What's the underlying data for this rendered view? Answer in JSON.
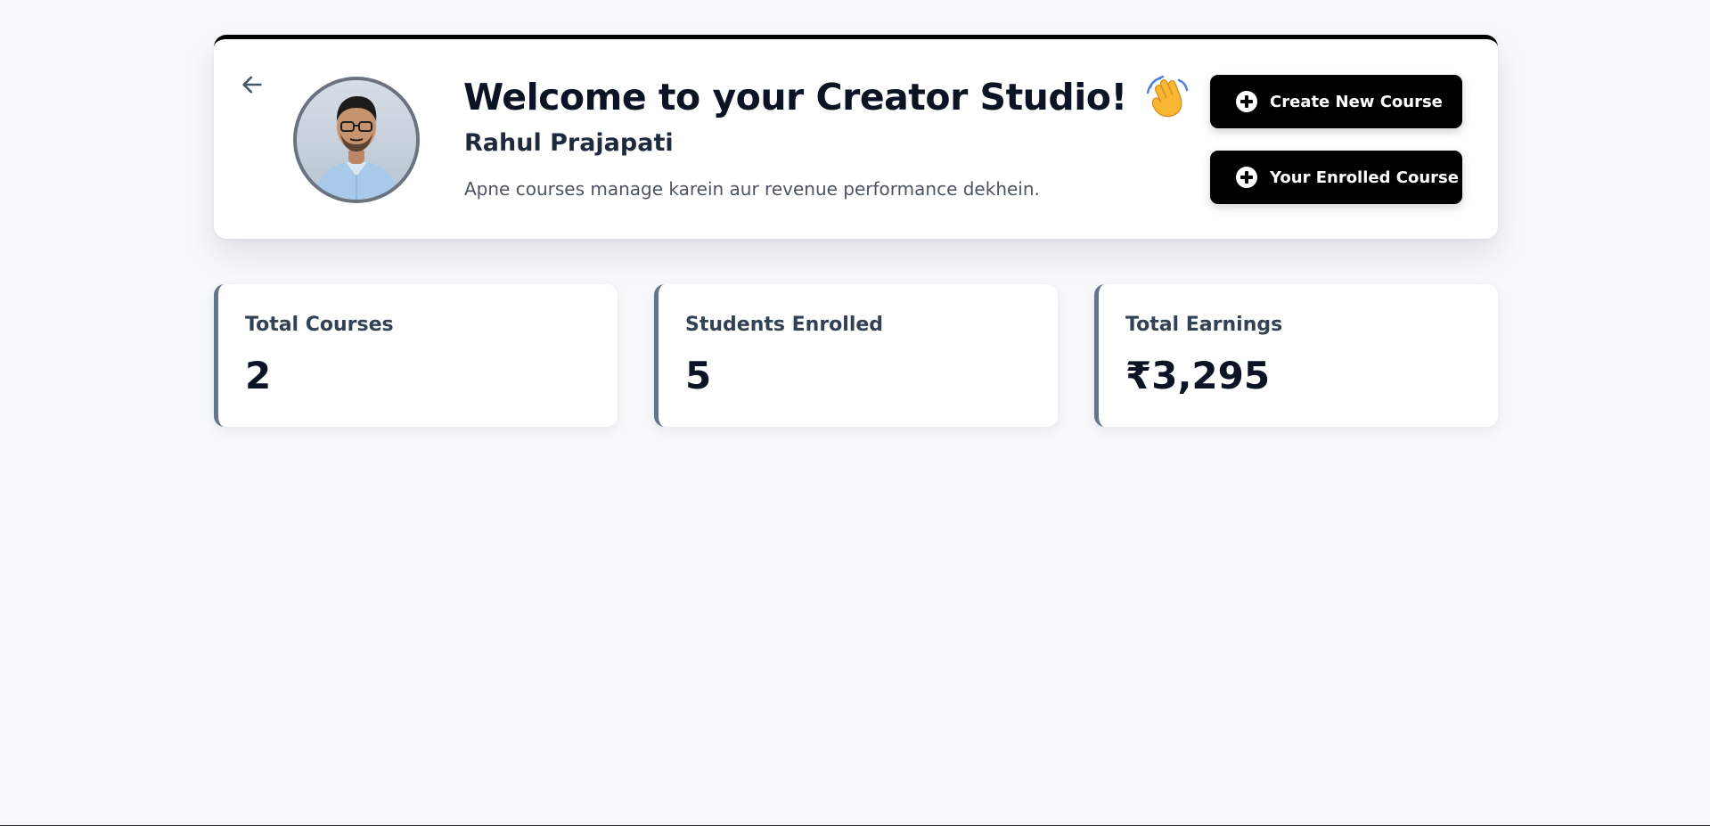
{
  "header": {
    "title": "Welcome to your Creator Studio!",
    "user_name": "Rahul Prajapati",
    "subtitle": "Apne courses manage karein aur revenue performance dekhein.",
    "wave_emoji": "👋"
  },
  "actions": {
    "create_label": "Create New Course",
    "enrolled_label": "Your Enrolled Course"
  },
  "stats": [
    {
      "label": "Total Courses",
      "value": "2"
    },
    {
      "label": "Students Enrolled",
      "value": "5"
    },
    {
      "label": "Total Earnings",
      "value": "₹3,295"
    }
  ],
  "colors": {
    "background": "#f8f9fb",
    "card": "#ffffff",
    "accent": "#000000",
    "stat_border": "#64748b",
    "heading": "#0b1324",
    "muted_text": "#4b5563"
  },
  "icons": {
    "back": "arrow-left-icon",
    "plus": "plus-circle-icon",
    "wave": "waving-hand-icon"
  }
}
